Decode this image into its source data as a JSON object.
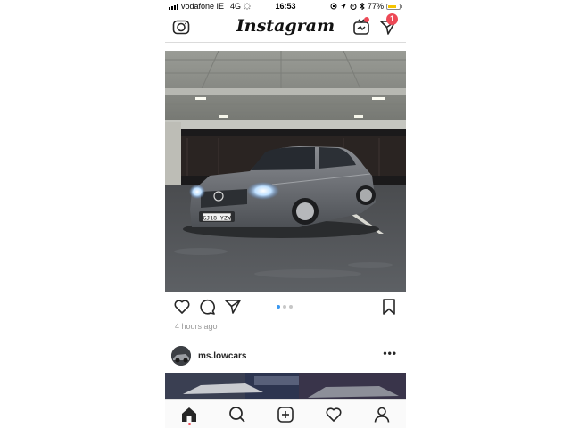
{
  "status_bar": {
    "carrier": "vodafone IE",
    "network": "4G",
    "time": "16:53",
    "battery_percent": "77%",
    "battery_level": 0.77
  },
  "header": {
    "logo_text": "Instagram",
    "direct_badge_count": "1"
  },
  "post": {
    "image_alt": "car-photo",
    "carousel_count": 3,
    "carousel_active_index": 0,
    "timestamp": "4 hours ago",
    "plate_text": "GJ18 YZW"
  },
  "next_post": {
    "username": "ms.lowcars",
    "more_label": "•••"
  },
  "icons": {
    "camera": "camera-icon",
    "igtv": "igtv-icon",
    "direct": "paper-plane-icon",
    "like": "heart-icon",
    "comment": "comment-icon",
    "share": "share-icon",
    "save": "bookmark-icon",
    "home": "home-icon",
    "search": "search-icon",
    "new_post": "new-post-icon",
    "activity": "activity-heart-icon",
    "profile": "profile-icon"
  },
  "colors": {
    "notification_red": "#ed4956",
    "carousel_active": "#3897f0",
    "battery_yellow": "#f5c400"
  }
}
